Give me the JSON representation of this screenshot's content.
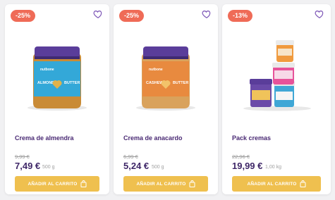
{
  "products": [
    {
      "badge": "-25%",
      "name": "Crema de almendra",
      "old_price": "9,99 €",
      "price": "7,49 €",
      "weight": "500 g",
      "cart_label": "AÑADIR AL CARRITO",
      "jar_label_color": "#33a8d8",
      "jar_text": "ALMOND BUTTER",
      "brand": "nutbone"
    },
    {
      "badge": "-25%",
      "name": "Crema de anacardo",
      "old_price": "6,99 €",
      "price": "5,24 €",
      "weight": "500 g",
      "cart_label": "AÑADIR AL CARRITO",
      "jar_label_color": "#e88a3f",
      "jar_text": "CASHEW BUTTER",
      "brand": "nutbone"
    },
    {
      "badge": "-13%",
      "name": "Pack cremas",
      "old_price": "22,96 €",
      "price": "19,99 €",
      "weight": "1,00 kg",
      "cart_label": "AÑADIR AL CARRITO"
    }
  ],
  "colors": {
    "badge": "#ef6b57",
    "cart_button": "#efc04f",
    "name": "#4a2a74",
    "lid": "#5a3d9a"
  },
  "icons": {
    "favorite": "heart-outline-icon",
    "cart": "shopping-bag-icon"
  }
}
